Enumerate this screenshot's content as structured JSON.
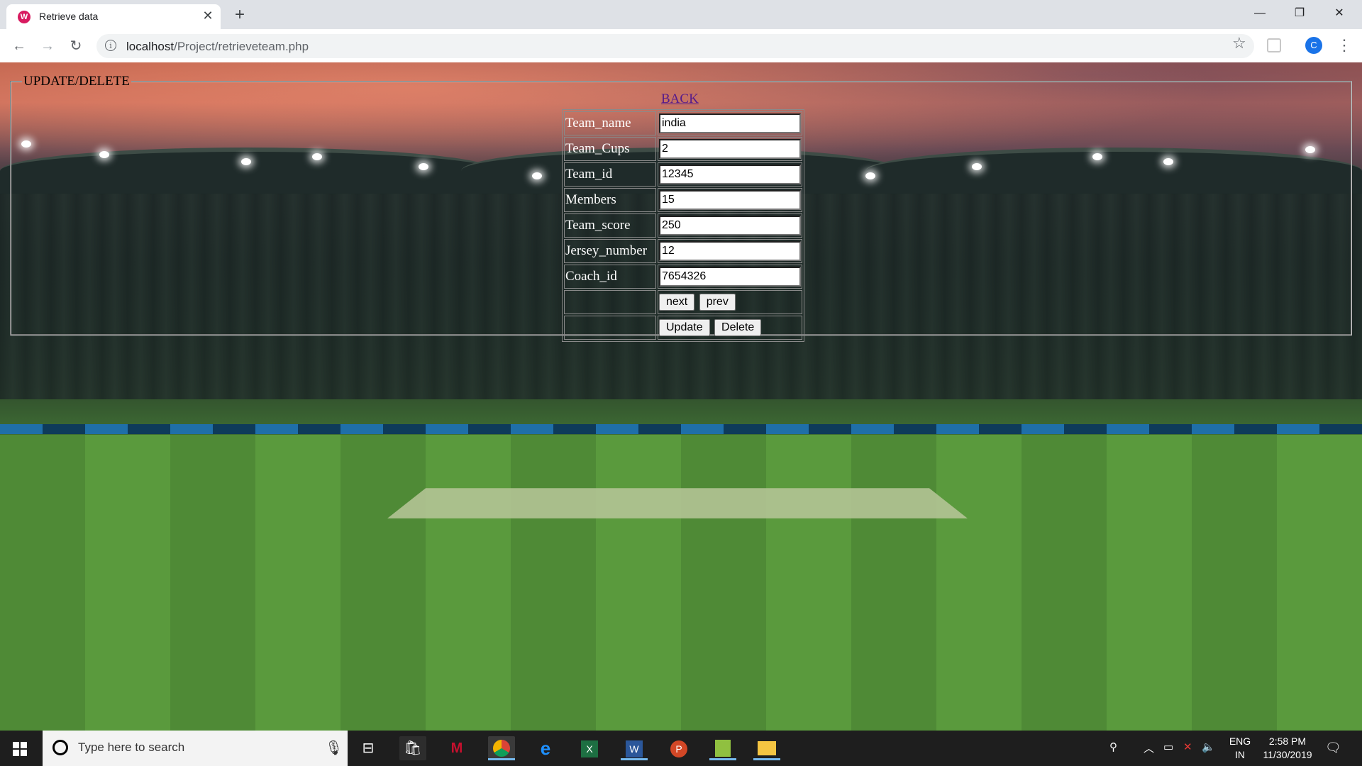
{
  "browser": {
    "tab_title": "Retrieve data",
    "tab_close": "✕",
    "new_tab": "+",
    "url_host": "localhost",
    "url_path": "/Project/retrieveteam.php",
    "profile_initial": "C",
    "window_controls": {
      "minimize": "—",
      "restore": "❐",
      "close": "✕"
    }
  },
  "page": {
    "legend": "UPDATE/DELETE",
    "back_link": "BACK",
    "fields": [
      {
        "label": "Team_name",
        "value": "india"
      },
      {
        "label": "Team_Cups",
        "value": "2"
      },
      {
        "label": "Team_id",
        "value": "12345"
      },
      {
        "label": "Members",
        "value": "15"
      },
      {
        "label": "Team_score",
        "value": "250"
      },
      {
        "label": "Jersey_number",
        "value": "12"
      },
      {
        "label": "Coach_id",
        "value": "7654326"
      }
    ],
    "buttons": {
      "next": "next",
      "prev": "prev",
      "update": "Update",
      "delete": "Delete"
    }
  },
  "taskbar": {
    "search_placeholder": "Type here to search",
    "language": "ENG",
    "region": "IN",
    "time": "2:58 PM",
    "date": "11/30/2019",
    "apps": [
      "task-view",
      "microsoft-store",
      "mcafee",
      "chrome",
      "edge",
      "excel",
      "word",
      "powerpoint",
      "notepad-plus",
      "file-explorer"
    ]
  },
  "colors": {
    "link_visited": "#551a8b",
    "label_text": "#ffffff",
    "taskbar_bg": "#1e1e1e",
    "chrome_blue": "#1a73e8"
  }
}
